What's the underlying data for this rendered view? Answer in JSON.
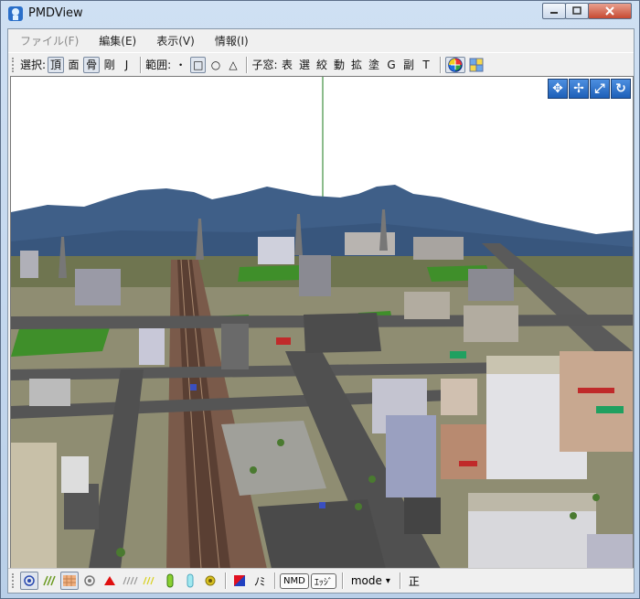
{
  "window": {
    "title": "PMDView"
  },
  "menu": [
    {
      "label": "ファイル(F)",
      "disabled": true
    },
    {
      "label": "編集(E)",
      "disabled": false
    },
    {
      "label": "表示(V)",
      "disabled": false
    },
    {
      "label": "情報(I)",
      "disabled": false
    }
  ],
  "toolbar": {
    "select_label": "選択:",
    "select_buttons": [
      "頂",
      "面",
      "骨",
      "剛",
      "J"
    ],
    "range_label": "範囲:",
    "range_buttons": [
      "・",
      "□",
      "○",
      "△"
    ],
    "subwindow_label": "子窓:",
    "subwindow_buttons": [
      "表",
      "選",
      "絞",
      "動",
      "拡",
      "塗",
      "G",
      "副",
      "T"
    ]
  },
  "statusbar": {
    "normal_label": "ﾉﾐ",
    "md_label": "NMD",
    "edge_label": "ｴｯｼﾞ",
    "mode_label": "mode",
    "mode_arrow": "▾",
    "right_label": "正"
  },
  "icons": {
    "app": "pmd-app-icon",
    "nav": [
      "move-xy-icon",
      "move-xyz-icon",
      "zoom-icon",
      "rotate-icon"
    ]
  },
  "colors": {
    "sky": "#ffffff",
    "mountain": "#3f5f88",
    "ground": "#8a8a6a",
    "road": "#555555",
    "accent": "#1d5fb8"
  }
}
